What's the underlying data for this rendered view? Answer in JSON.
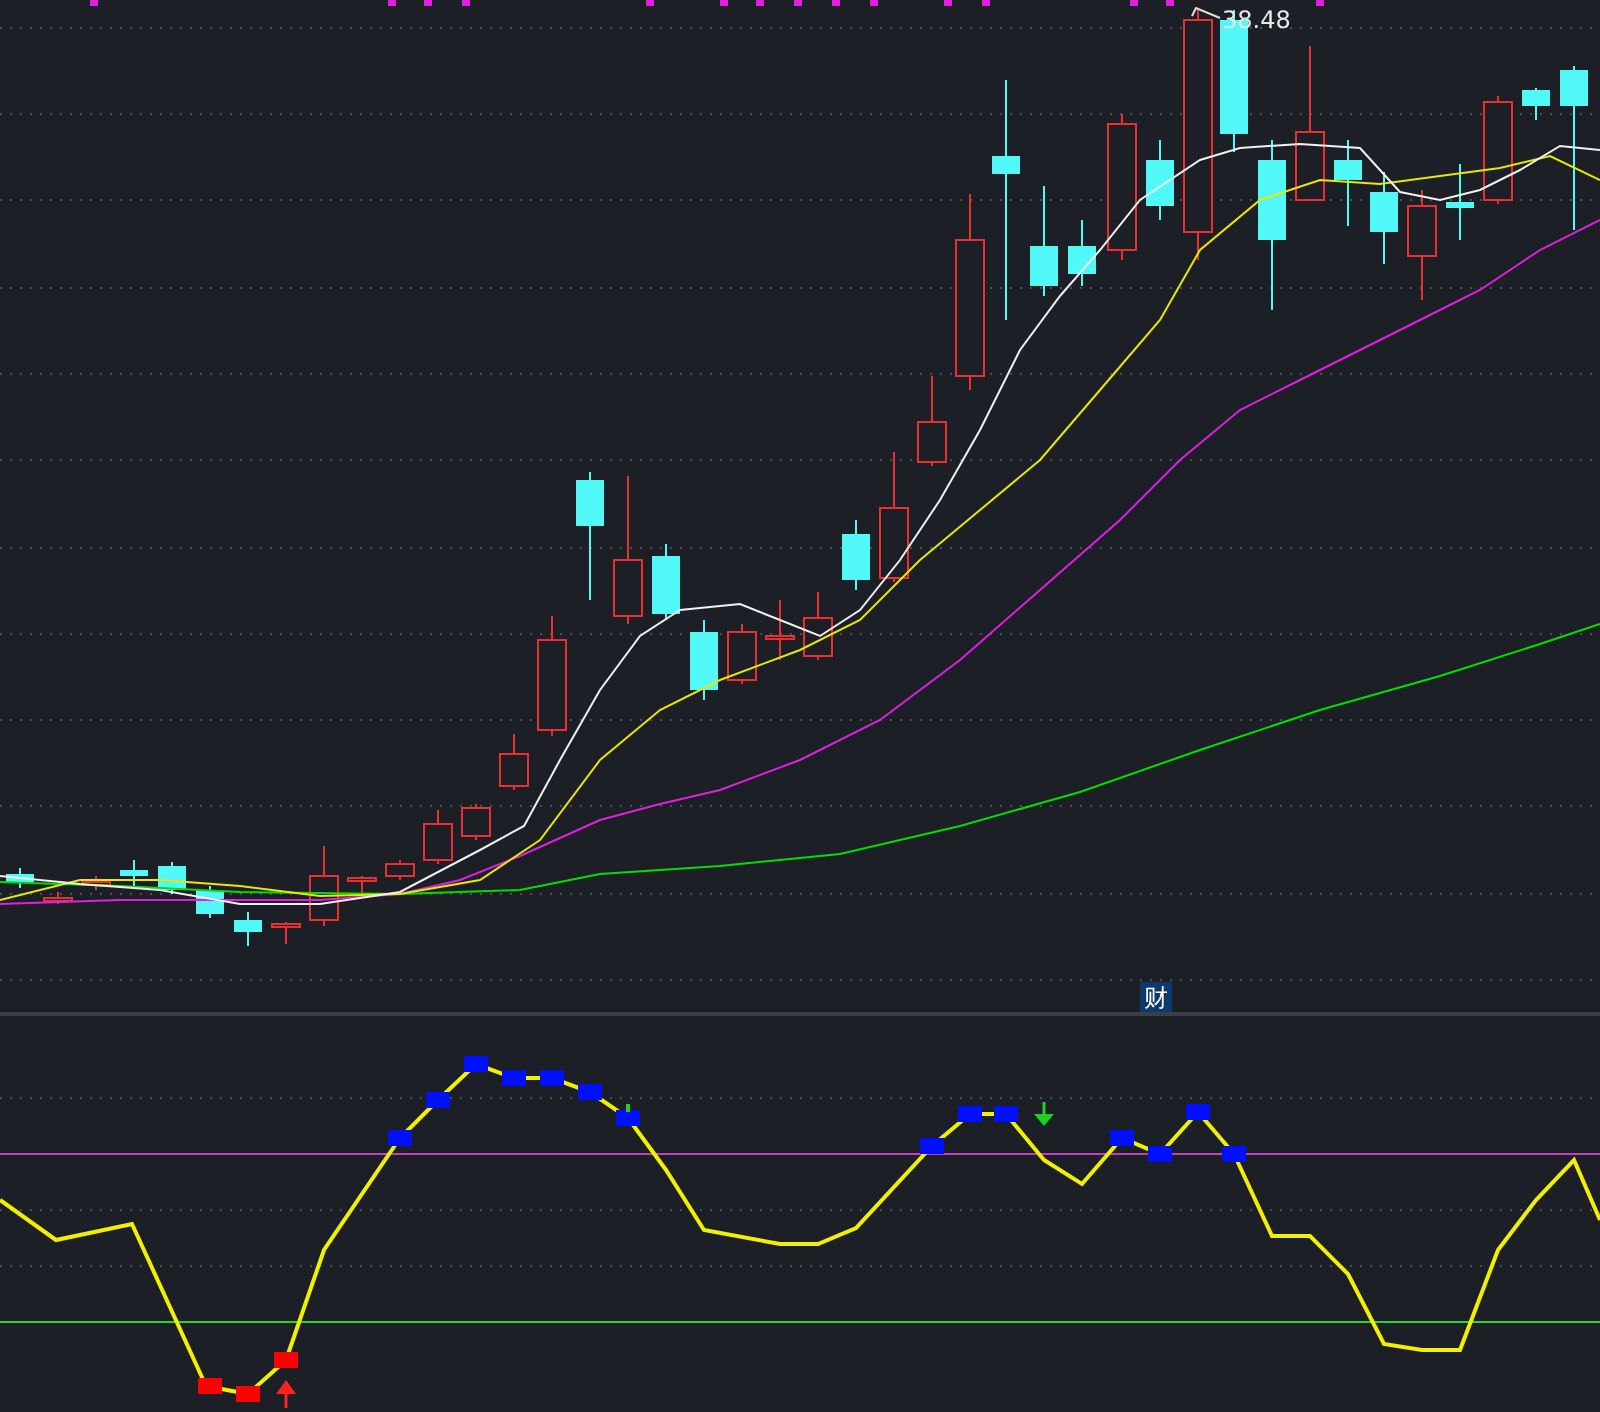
{
  "price_chart": {
    "high_label": "38.48"
  },
  "indicator_panel": {
    "label": "财"
  }
}
